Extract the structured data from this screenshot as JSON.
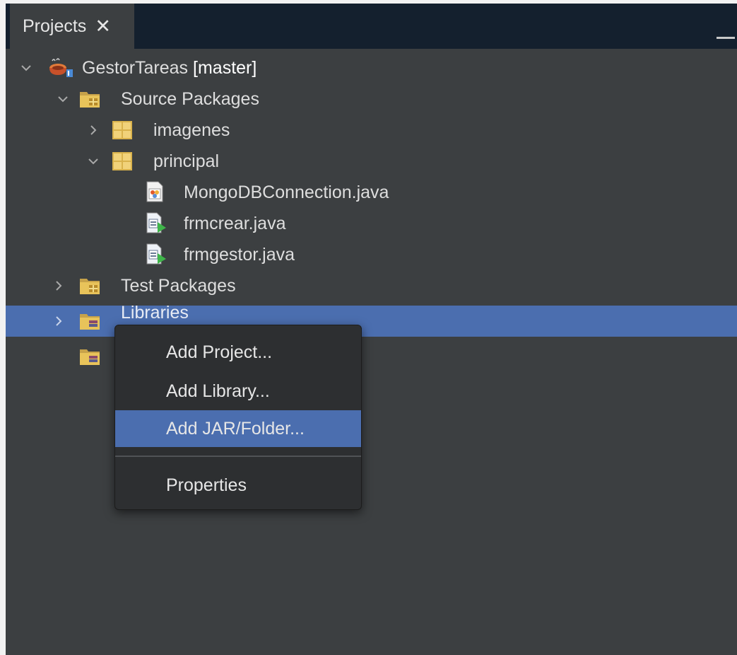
{
  "panel": {
    "tab_label": "Projects",
    "tab_close": "✕"
  },
  "tree": {
    "project_name": "GestorTareas",
    "project_branch": "[master]",
    "source_packages": "Source Packages",
    "pkg_imagenes": "imagenes",
    "pkg_principal": "principal",
    "file_mongo": "MongoDBConnection.java",
    "file_frmcrear": "frmcrear.java",
    "file_frmgestor": "frmgestor.java",
    "test_packages": "Test Packages",
    "libraries": "Libraries"
  },
  "context_menu": {
    "items": [
      "Add Project...",
      "Add Library...",
      "Add JAR/Folder...",
      "Properties"
    ],
    "highlighted": "Add JAR/Folder..."
  },
  "colors": {
    "background": "#3c3f41",
    "selection": "#4b6eaf",
    "menu_bg": "#2d2f31",
    "tabbar": "#14202e"
  }
}
